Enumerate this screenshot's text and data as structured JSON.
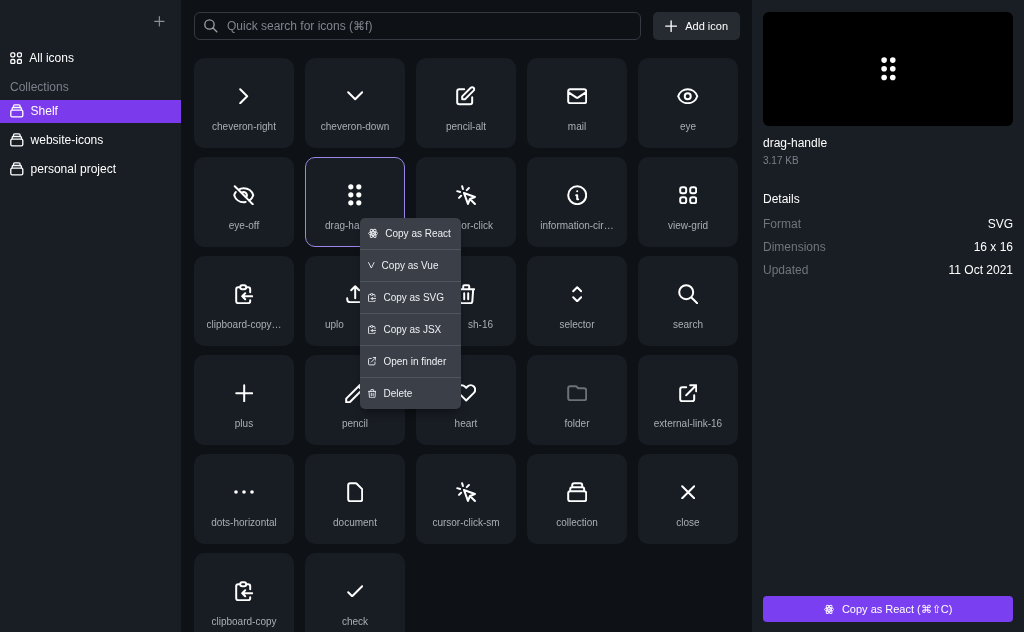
{
  "sidebar": {
    "all_icons": "All icons",
    "section": "Collections",
    "items": [
      {
        "label": "Shelf",
        "selected": true
      },
      {
        "label": "website-icons",
        "selected": false
      },
      {
        "label": "personal project",
        "selected": false
      }
    ]
  },
  "search": {
    "placeholder": "Quick search for icons (⌘f)"
  },
  "add_button": "Add icon",
  "icons": [
    {
      "label": "cheveron-right",
      "selected": false
    },
    {
      "label": "cheveron-down",
      "selected": false
    },
    {
      "label": "pencil-alt",
      "selected": false
    },
    {
      "label": "mail",
      "selected": false
    },
    {
      "label": "eye",
      "selected": false
    },
    {
      "label": "eye-off",
      "selected": false
    },
    {
      "label": "drag-ha",
      "selected": true,
      "covered_end": true
    },
    {
      "label": "or-click",
      "selected": false,
      "covered_start": true
    },
    {
      "label": "information-cir…",
      "selected": false
    },
    {
      "label": "view-grid",
      "selected": false
    },
    {
      "label": "clipboard-copy…",
      "selected": false
    },
    {
      "label": "uplo",
      "selected": false,
      "covered_end": true
    },
    {
      "label": "sh-16",
      "selected": false,
      "covered_start": true
    },
    {
      "label": "selector",
      "selected": false
    },
    {
      "label": "search",
      "selected": false
    },
    {
      "label": "plus",
      "selected": false
    },
    {
      "label": "pencil",
      "selected": false
    },
    {
      "label": "heart",
      "selected": false
    },
    {
      "label": "folder",
      "selected": false
    },
    {
      "label": "external-link-16",
      "selected": false
    },
    {
      "label": "dots-horizontal",
      "selected": false
    },
    {
      "label": "document",
      "selected": false
    },
    {
      "label": "cursor-click-sm",
      "selected": false
    },
    {
      "label": "collection",
      "selected": false
    },
    {
      "label": "close",
      "selected": false
    },
    {
      "label": "clipboard-copy",
      "selected": false
    },
    {
      "label": "check",
      "selected": false
    }
  ],
  "context_menu": [
    "Copy as React",
    "Copy as Vue",
    "Copy as SVG",
    "Copy as JSX",
    "Open in finder",
    "Delete"
  ],
  "details": {
    "name": "drag-handle",
    "size": "3.17 KB",
    "heading": "Details",
    "rows": [
      {
        "label": "Format",
        "value": "SVG"
      },
      {
        "label": "Dimensions",
        "value": "16 x 16"
      },
      {
        "label": "Updated",
        "value": "11 Oct 2021"
      }
    ],
    "button": "Copy as React (⌘⇧C)"
  }
}
